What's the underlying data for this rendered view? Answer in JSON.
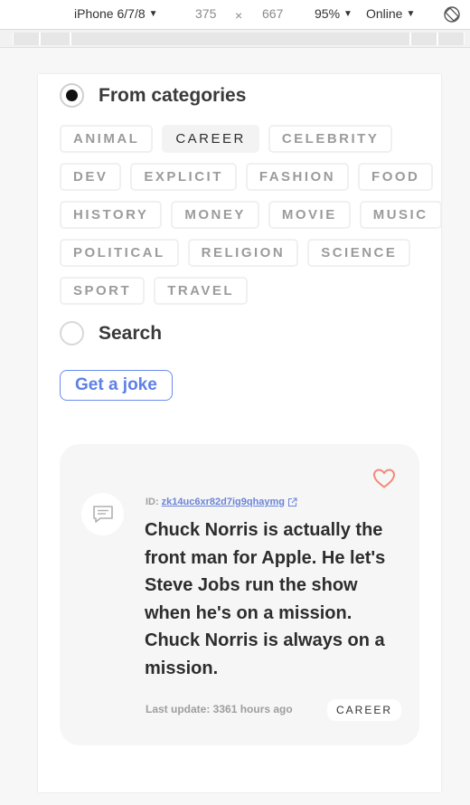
{
  "devtools": {
    "device": "iPhone 6/7/8",
    "width": "375",
    "times": "×",
    "height": "667",
    "zoom": "95%",
    "network": "Online"
  },
  "form": {
    "categories_option": "From categories",
    "search_option": "Search",
    "selected_option": "categories",
    "categories": [
      [
        "ANIMAL",
        "CAREER",
        "CELEBRITY"
      ],
      [
        "DEV",
        "EXPLICIT",
        "FASHION",
        "FOOD"
      ],
      [
        "HISTORY",
        "MONEY",
        "MOVIE",
        "MUSIC"
      ],
      [
        "POLITICAL",
        "RELIGION",
        "SCIENCE"
      ],
      [
        "SPORT",
        "TRAVEL"
      ]
    ],
    "active_category": "CAREER",
    "button_label": "Get a joke"
  },
  "joke": {
    "id_label": "ID:",
    "id": "zk14uc6xr82d7ig9qhaymg",
    "text": "Chuck Norris is actually the front man for Apple. He let's Steve Jobs run the show when he's on a mission. Chuck Norris is always on a mission.",
    "last_update": "Last update: 3361 hours ago",
    "category": "CAREER",
    "favorite": false
  },
  "colors": {
    "accent": "#5e80e8",
    "heart": "#f08a7a",
    "card_bg": "#f6f6f6"
  },
  "icons": {
    "rotate": "rotate-device-icon",
    "heart": "heart-icon",
    "avatar": "chat-bubble-icon",
    "external": "external-link-icon"
  }
}
